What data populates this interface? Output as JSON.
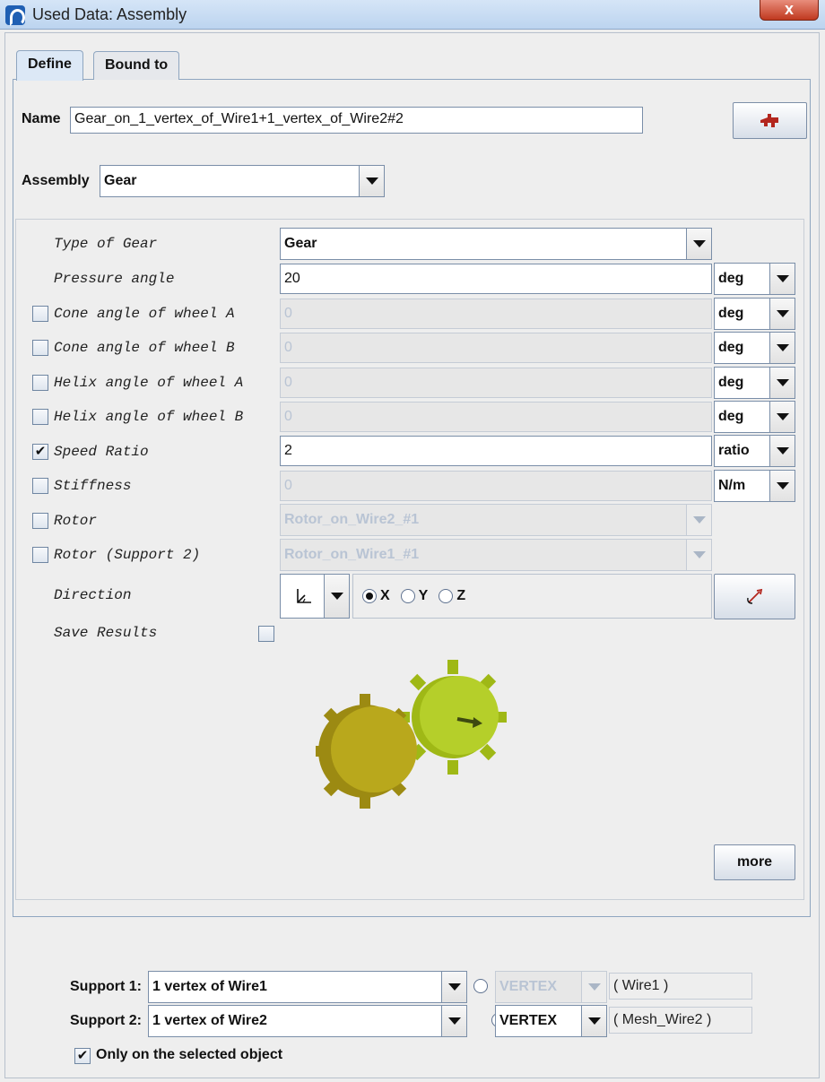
{
  "window": {
    "title": "Used Data: Assembly",
    "close_label": "x"
  },
  "tabs": [
    {
      "label": "Define"
    },
    {
      "label": "Bound to"
    }
  ],
  "name_row": {
    "label": "Name",
    "value": "Gear_on_1_vertex_of_Wire1+1_vertex_of_Wire2#2"
  },
  "assembly_row": {
    "label": "Assembly",
    "value": "Gear"
  },
  "params": {
    "type_of_gear": {
      "label": "Type of Gear",
      "value": "Gear"
    },
    "pressure_angle": {
      "label": "Pressure angle",
      "value": "20",
      "unit": "deg"
    },
    "cone_a": {
      "label": "Cone angle of wheel A",
      "value": "0",
      "unit": "deg",
      "checked": ""
    },
    "cone_b": {
      "label": "Cone angle of wheel B",
      "value": "0",
      "unit": "deg",
      "checked": ""
    },
    "helix_a": {
      "label": "Helix angle of wheel A",
      "value": "0",
      "unit": "deg",
      "checked": ""
    },
    "helix_b": {
      "label": "Helix angle of wheel B",
      "value": "0",
      "unit": "deg",
      "checked": ""
    },
    "speed_ratio": {
      "label": "Speed Ratio",
      "value": "2",
      "unit": "ratio",
      "checked": "✔"
    },
    "stiffness": {
      "label": "Stiffness",
      "value": "0",
      "unit": "N/m",
      "checked": ""
    },
    "rotor": {
      "label": "Rotor",
      "value": "Rotor_on_Wire2_#1",
      "checked": ""
    },
    "rotor_support2": {
      "label": "Rotor (Support 2)",
      "value": "Rotor_on_Wire1_#1",
      "checked": ""
    },
    "direction": {
      "label": "Direction",
      "options": [
        "X",
        "Y",
        "Z"
      ],
      "selected": "X"
    },
    "save_results": {
      "label": "Save Results",
      "checked": ""
    }
  },
  "more_button": "more",
  "supports": {
    "support1": {
      "label": "Support 1:",
      "value": "1 vertex of Wire1",
      "type": "VERTEX",
      "target": "( Wire1 )"
    },
    "support2": {
      "label": "Support 2:",
      "value": "1 vertex of Wire2",
      "type": "VERTEX",
      "target": "( Mesh_Wire2 )"
    }
  },
  "only_selected": {
    "label": "Only on the selected object",
    "checked": "✔"
  },
  "colors": {
    "gear_left": "#b9a81c",
    "gear_right": "#a9c21a",
    "titlebar": "#c8dcf2",
    "close": "#c8452c"
  }
}
